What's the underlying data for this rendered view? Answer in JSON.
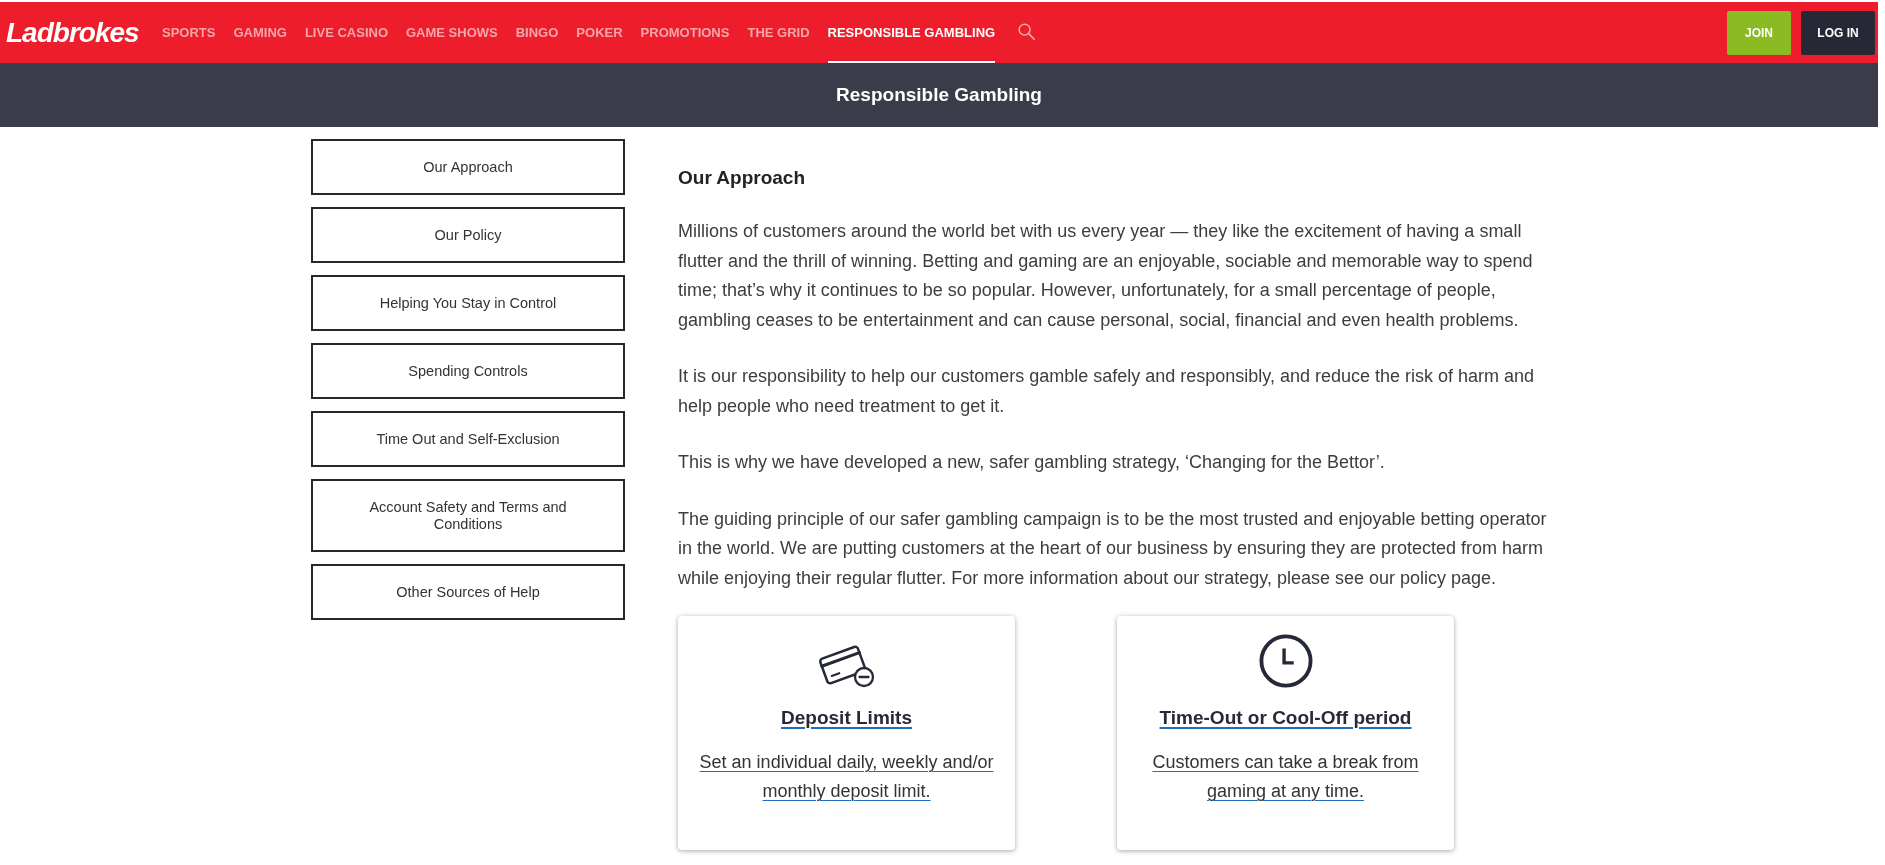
{
  "header": {
    "logo": "Ladbrokes",
    "nav": [
      {
        "label": "SPORTS",
        "selected": false
      },
      {
        "label": "GAMING",
        "selected": false
      },
      {
        "label": "LIVE CASINO",
        "selected": false
      },
      {
        "label": "GAME SHOWS",
        "selected": false
      },
      {
        "label": "BINGO",
        "selected": false
      },
      {
        "label": "POKER",
        "selected": false
      },
      {
        "label": "PROMOTIONS",
        "selected": false
      },
      {
        "label": "THE GRID",
        "selected": false
      },
      {
        "label": "RESPONSIBLE GAMBLING",
        "selected": true
      }
    ],
    "actions": [
      {
        "label": "JOIN",
        "kind": "primary"
      },
      {
        "label": "LOG IN",
        "kind": "secondary"
      }
    ]
  },
  "page_title": "Responsible Gambling",
  "sidebar": {
    "items": [
      {
        "label": "Our Approach"
      },
      {
        "label": "Our Policy"
      },
      {
        "label": "Helping You Stay in Control"
      },
      {
        "label": "Spending Controls"
      },
      {
        "label": "Time Out and Self-Exclusion"
      },
      {
        "label": "Account Safety and Terms and Conditions"
      },
      {
        "label": "Other Sources of Help"
      }
    ]
  },
  "article": {
    "heading": "Our Approach",
    "paragraphs": [
      "Millions of customers around the world bet with us every year — they like the excitement of having a small flutter and the thrill of winning. Betting and gaming are an enjoyable, sociable and memorable way to spend time; that’s why it continues to be so popular. However, unfortunately, for a small percentage of people, gambling ceases to be entertainment and can cause personal, social, financial and even health problems.",
      "It is our responsibility to help our customers gamble safely and responsibly, and reduce the risk of harm and help people who need treatment to get it.",
      "This is why we have developed a new, safer gambling strategy, ‘Changing for the Bettor’.",
      "The guiding principle of our safer gambling campaign is to be the most trusted and enjoyable betting operator in the world. We are putting customers at the heart of our business by ensuring they are protected from harm while enjoying their regular flutter. For more information about our strategy, please see our policy page."
    ]
  },
  "cards": [
    {
      "kind": "deposit",
      "title": "Deposit Limits",
      "description": "Set an individual daily, weekly and/or monthly deposit limit."
    },
    {
      "kind": "timeout",
      "title": "Time-Out or Cool-Off period",
      "description": "Customers can take a break from gaming at any time."
    }
  ]
}
